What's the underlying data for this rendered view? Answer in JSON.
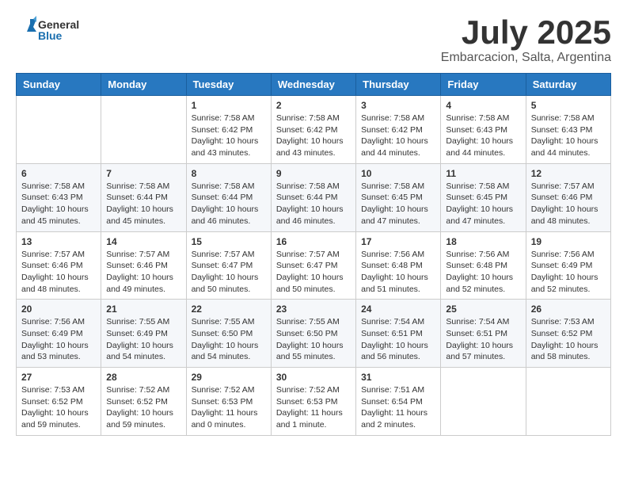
{
  "header": {
    "logo": {
      "general": "General",
      "blue": "Blue"
    },
    "title": "July 2025",
    "subtitle": "Embarcacion, Salta, Argentina"
  },
  "weekdays": [
    "Sunday",
    "Monday",
    "Tuesday",
    "Wednesday",
    "Thursday",
    "Friday",
    "Saturday"
  ],
  "weeks": [
    [
      {
        "day": "",
        "sunrise": "",
        "sunset": "",
        "daylight": ""
      },
      {
        "day": "",
        "sunrise": "",
        "sunset": "",
        "daylight": ""
      },
      {
        "day": "1",
        "sunrise": "Sunrise: 7:58 AM",
        "sunset": "Sunset: 6:42 PM",
        "daylight": "Daylight: 10 hours and 43 minutes."
      },
      {
        "day": "2",
        "sunrise": "Sunrise: 7:58 AM",
        "sunset": "Sunset: 6:42 PM",
        "daylight": "Daylight: 10 hours and 43 minutes."
      },
      {
        "day": "3",
        "sunrise": "Sunrise: 7:58 AM",
        "sunset": "Sunset: 6:42 PM",
        "daylight": "Daylight: 10 hours and 44 minutes."
      },
      {
        "day": "4",
        "sunrise": "Sunrise: 7:58 AM",
        "sunset": "Sunset: 6:43 PM",
        "daylight": "Daylight: 10 hours and 44 minutes."
      },
      {
        "day": "5",
        "sunrise": "Sunrise: 7:58 AM",
        "sunset": "Sunset: 6:43 PM",
        "daylight": "Daylight: 10 hours and 44 minutes."
      }
    ],
    [
      {
        "day": "6",
        "sunrise": "Sunrise: 7:58 AM",
        "sunset": "Sunset: 6:43 PM",
        "daylight": "Daylight: 10 hours and 45 minutes."
      },
      {
        "day": "7",
        "sunrise": "Sunrise: 7:58 AM",
        "sunset": "Sunset: 6:44 PM",
        "daylight": "Daylight: 10 hours and 45 minutes."
      },
      {
        "day": "8",
        "sunrise": "Sunrise: 7:58 AM",
        "sunset": "Sunset: 6:44 PM",
        "daylight": "Daylight: 10 hours and 46 minutes."
      },
      {
        "day": "9",
        "sunrise": "Sunrise: 7:58 AM",
        "sunset": "Sunset: 6:44 PM",
        "daylight": "Daylight: 10 hours and 46 minutes."
      },
      {
        "day": "10",
        "sunrise": "Sunrise: 7:58 AM",
        "sunset": "Sunset: 6:45 PM",
        "daylight": "Daylight: 10 hours and 47 minutes."
      },
      {
        "day": "11",
        "sunrise": "Sunrise: 7:58 AM",
        "sunset": "Sunset: 6:45 PM",
        "daylight": "Daylight: 10 hours and 47 minutes."
      },
      {
        "day": "12",
        "sunrise": "Sunrise: 7:57 AM",
        "sunset": "Sunset: 6:46 PM",
        "daylight": "Daylight: 10 hours and 48 minutes."
      }
    ],
    [
      {
        "day": "13",
        "sunrise": "Sunrise: 7:57 AM",
        "sunset": "Sunset: 6:46 PM",
        "daylight": "Daylight: 10 hours and 48 minutes."
      },
      {
        "day": "14",
        "sunrise": "Sunrise: 7:57 AM",
        "sunset": "Sunset: 6:46 PM",
        "daylight": "Daylight: 10 hours and 49 minutes."
      },
      {
        "day": "15",
        "sunrise": "Sunrise: 7:57 AM",
        "sunset": "Sunset: 6:47 PM",
        "daylight": "Daylight: 10 hours and 50 minutes."
      },
      {
        "day": "16",
        "sunrise": "Sunrise: 7:57 AM",
        "sunset": "Sunset: 6:47 PM",
        "daylight": "Daylight: 10 hours and 50 minutes."
      },
      {
        "day": "17",
        "sunrise": "Sunrise: 7:56 AM",
        "sunset": "Sunset: 6:48 PM",
        "daylight": "Daylight: 10 hours and 51 minutes."
      },
      {
        "day": "18",
        "sunrise": "Sunrise: 7:56 AM",
        "sunset": "Sunset: 6:48 PM",
        "daylight": "Daylight: 10 hours and 52 minutes."
      },
      {
        "day": "19",
        "sunrise": "Sunrise: 7:56 AM",
        "sunset": "Sunset: 6:49 PM",
        "daylight": "Daylight: 10 hours and 52 minutes."
      }
    ],
    [
      {
        "day": "20",
        "sunrise": "Sunrise: 7:56 AM",
        "sunset": "Sunset: 6:49 PM",
        "daylight": "Daylight: 10 hours and 53 minutes."
      },
      {
        "day": "21",
        "sunrise": "Sunrise: 7:55 AM",
        "sunset": "Sunset: 6:49 PM",
        "daylight": "Daylight: 10 hours and 54 minutes."
      },
      {
        "day": "22",
        "sunrise": "Sunrise: 7:55 AM",
        "sunset": "Sunset: 6:50 PM",
        "daylight": "Daylight: 10 hours and 54 minutes."
      },
      {
        "day": "23",
        "sunrise": "Sunrise: 7:55 AM",
        "sunset": "Sunset: 6:50 PM",
        "daylight": "Daylight: 10 hours and 55 minutes."
      },
      {
        "day": "24",
        "sunrise": "Sunrise: 7:54 AM",
        "sunset": "Sunset: 6:51 PM",
        "daylight": "Daylight: 10 hours and 56 minutes."
      },
      {
        "day": "25",
        "sunrise": "Sunrise: 7:54 AM",
        "sunset": "Sunset: 6:51 PM",
        "daylight": "Daylight: 10 hours and 57 minutes."
      },
      {
        "day": "26",
        "sunrise": "Sunrise: 7:53 AM",
        "sunset": "Sunset: 6:52 PM",
        "daylight": "Daylight: 10 hours and 58 minutes."
      }
    ],
    [
      {
        "day": "27",
        "sunrise": "Sunrise: 7:53 AM",
        "sunset": "Sunset: 6:52 PM",
        "daylight": "Daylight: 10 hours and 59 minutes."
      },
      {
        "day": "28",
        "sunrise": "Sunrise: 7:52 AM",
        "sunset": "Sunset: 6:52 PM",
        "daylight": "Daylight: 10 hours and 59 minutes."
      },
      {
        "day": "29",
        "sunrise": "Sunrise: 7:52 AM",
        "sunset": "Sunset: 6:53 PM",
        "daylight": "Daylight: 11 hours and 0 minutes."
      },
      {
        "day": "30",
        "sunrise": "Sunrise: 7:52 AM",
        "sunset": "Sunset: 6:53 PM",
        "daylight": "Daylight: 11 hours and 1 minute."
      },
      {
        "day": "31",
        "sunrise": "Sunrise: 7:51 AM",
        "sunset": "Sunset: 6:54 PM",
        "daylight": "Daylight: 11 hours and 2 minutes."
      },
      {
        "day": "",
        "sunrise": "",
        "sunset": "",
        "daylight": ""
      },
      {
        "day": "",
        "sunrise": "",
        "sunset": "",
        "daylight": ""
      }
    ]
  ]
}
